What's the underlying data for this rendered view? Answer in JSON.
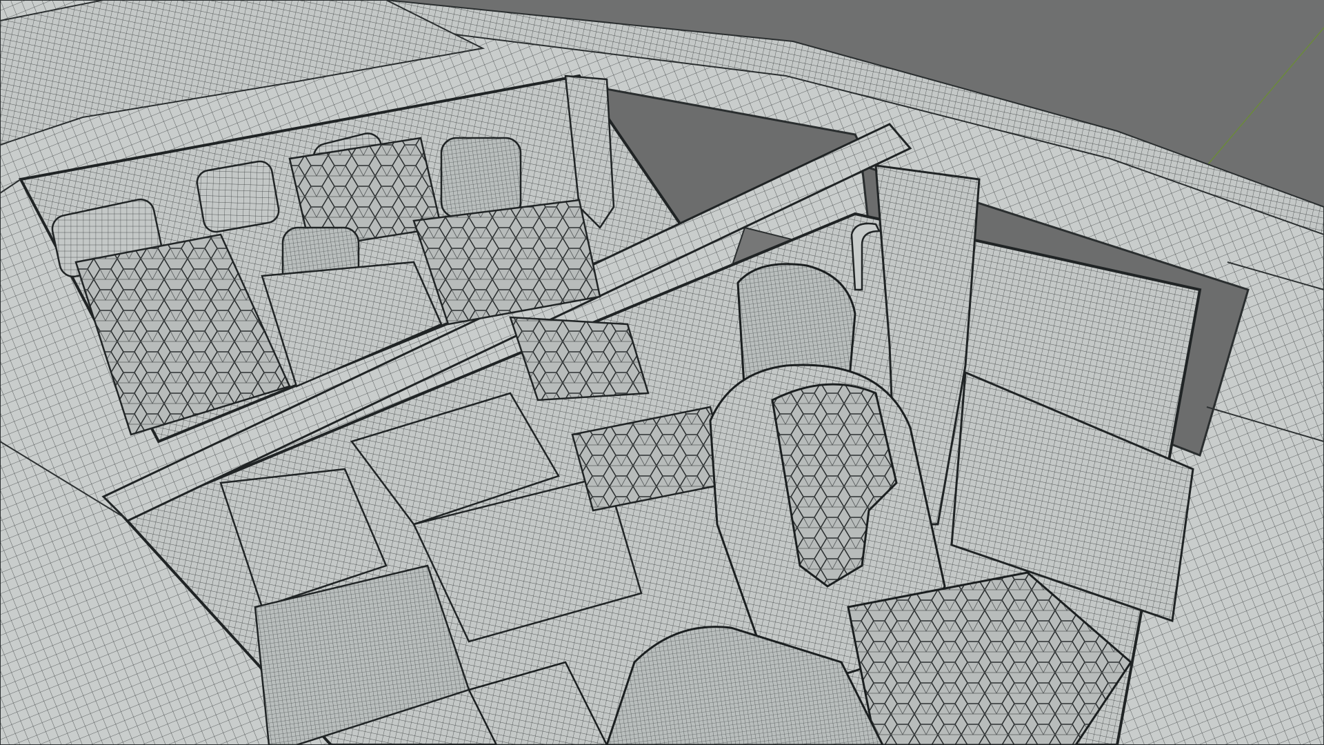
{
  "viewport": {
    "subject": "wireframe-car-interior",
    "background_color": "#6f7070",
    "model_color": "#c9cdcc",
    "wire_color": "#3b3f40",
    "grid_line_color": "#6b8a3a",
    "axis_line_color": "#9a2a2a"
  }
}
